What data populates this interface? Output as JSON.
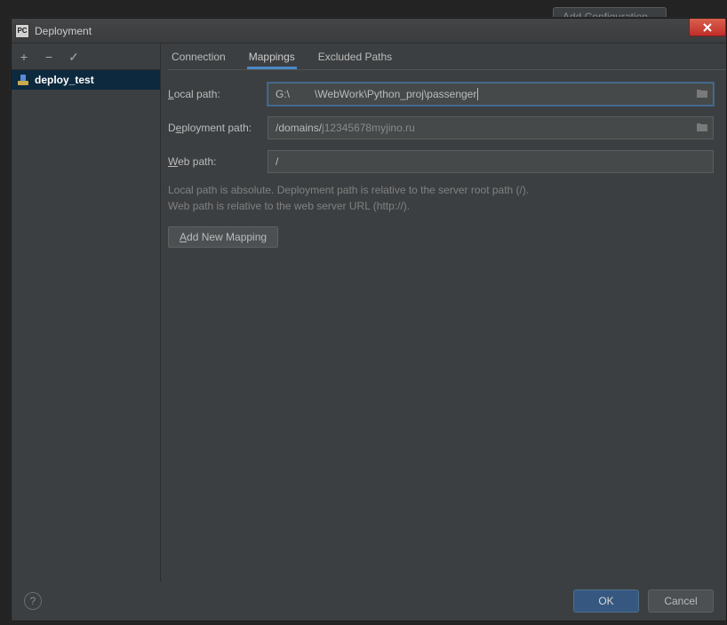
{
  "background": {
    "button_label": "Add Configuration..."
  },
  "dialog": {
    "app_icon_text": "PC",
    "title": "Deployment",
    "toolbar": {
      "add": "+",
      "remove": "−",
      "check": "✓"
    },
    "list": {
      "selected_label": "deploy_test"
    },
    "tabs": {
      "connection": "Connection",
      "mappings": "Mappings",
      "excluded": "Excluded Paths"
    },
    "fields": {
      "local_label": "Local path:",
      "local_value_prefix": "G:\\",
      "local_value_suffix": "\\WebWork\\Python_proj\\passenger",
      "deploy_label": "Deployment path:",
      "deploy_value_prefix": "/domains/",
      "deploy_value_suffix": "j12345678myjino.ru",
      "web_label": "Web path:",
      "web_value": "/"
    },
    "help_line1": "Local path is absolute. Deployment path is relative to the server root path (/).",
    "help_line2": "Web path is relative to the web server URL (http://).",
    "add_mapping_label": "Add New Mapping"
  },
  "footer": {
    "ok": "OK",
    "cancel": "Cancel"
  }
}
